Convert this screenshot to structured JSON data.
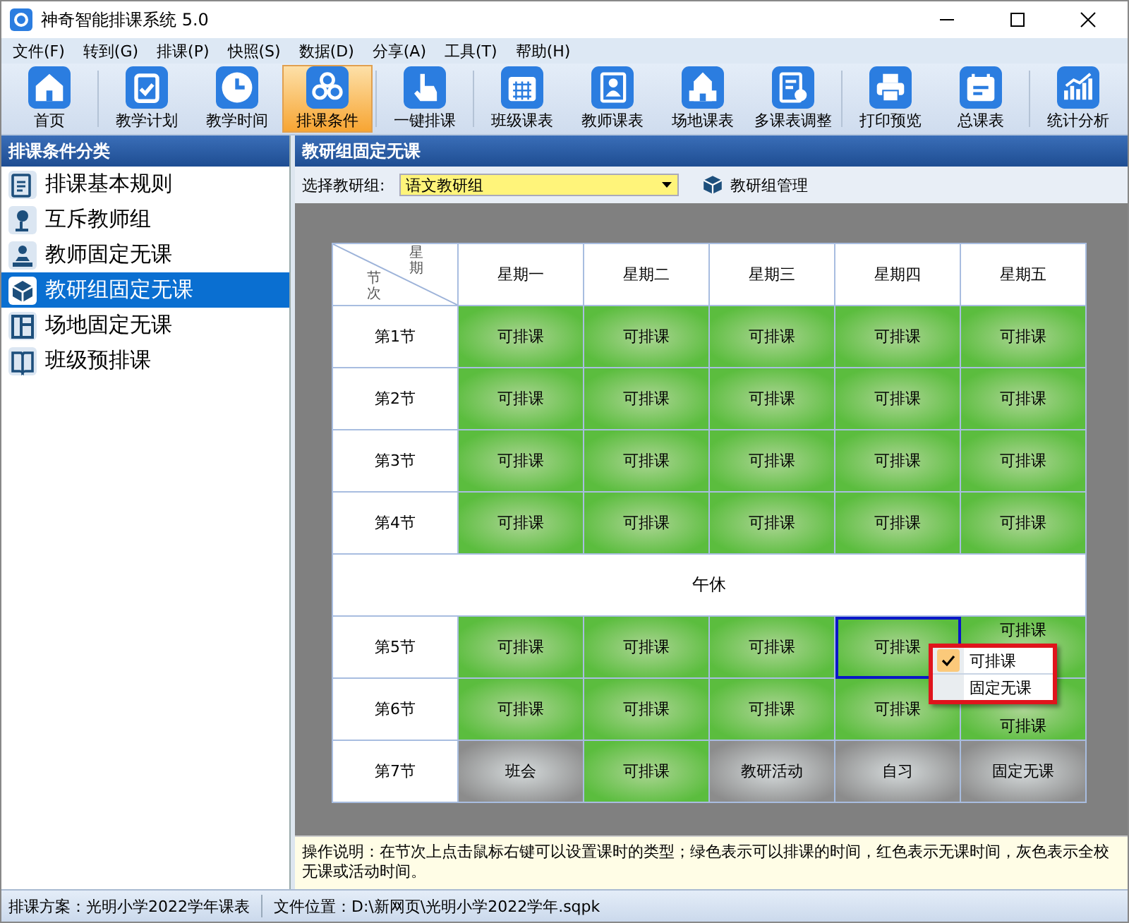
{
  "window": {
    "title": "神奇智能排课系统 5.0"
  },
  "menu": [
    "文件(F)",
    "转到(G)",
    "排课(P)",
    "快照(S)",
    "数据(D)",
    "分享(A)",
    "工具(T)",
    "帮助(H)"
  ],
  "toolbar": [
    [
      {
        "label": "首页",
        "selected": false
      }
    ],
    [
      {
        "label": "教学计划",
        "selected": false
      },
      {
        "label": "教学时间",
        "selected": false
      },
      {
        "label": "排课条件",
        "selected": true
      }
    ],
    [
      {
        "label": "一键排课",
        "selected": false
      }
    ],
    [
      {
        "label": "班级课表",
        "selected": false
      },
      {
        "label": "教师课表",
        "selected": false
      },
      {
        "label": "场地课表",
        "selected": false
      },
      {
        "label": "多课表调整",
        "selected": false
      }
    ],
    [
      {
        "label": "打印预览",
        "selected": false
      },
      {
        "label": "总课表",
        "selected": false
      }
    ],
    [
      {
        "label": "统计分析",
        "selected": false
      }
    ]
  ],
  "sidebar": {
    "title": "排课条件分类",
    "items": [
      {
        "label": "排课基本规则",
        "selected": false
      },
      {
        "label": "互斥教师组",
        "selected": false
      },
      {
        "label": "教师固定无课",
        "selected": false
      },
      {
        "label": "教研组固定无课",
        "selected": true
      },
      {
        "label": "场地固定无课",
        "selected": false
      },
      {
        "label": "班级预排课",
        "selected": false
      }
    ]
  },
  "panel": {
    "title": "教研组固定无课",
    "select_label": "选择教研组:",
    "select_value": "语文教研组",
    "manage_button": "教研组管理"
  },
  "table": {
    "corner_top": "星期",
    "corner_bottom": "节次",
    "columns": [
      "星期一",
      "星期二",
      "星期三",
      "星期四",
      "星期五"
    ],
    "rows": [
      {
        "kind": "period",
        "label": "第1节",
        "cells": [
          {
            "text": "可排课",
            "kind": "free",
            "selected": false
          },
          {
            "text": "可排课",
            "kind": "free",
            "selected": false
          },
          {
            "text": "可排课",
            "kind": "free",
            "selected": false
          },
          {
            "text": "可排课",
            "kind": "free",
            "selected": false
          },
          {
            "text": "可排课",
            "kind": "free",
            "selected": false
          }
        ]
      },
      {
        "kind": "period",
        "label": "第2节",
        "cells": [
          {
            "text": "可排课",
            "kind": "free",
            "selected": false
          },
          {
            "text": "可排课",
            "kind": "free",
            "selected": false
          },
          {
            "text": "可排课",
            "kind": "free",
            "selected": false
          },
          {
            "text": "可排课",
            "kind": "free",
            "selected": false
          },
          {
            "text": "可排课",
            "kind": "free",
            "selected": false
          }
        ]
      },
      {
        "kind": "period",
        "label": "第3节",
        "cells": [
          {
            "text": "可排课",
            "kind": "free",
            "selected": false
          },
          {
            "text": "可排课",
            "kind": "free",
            "selected": false
          },
          {
            "text": "可排课",
            "kind": "free",
            "selected": false
          },
          {
            "text": "可排课",
            "kind": "free",
            "selected": false
          },
          {
            "text": "可排课",
            "kind": "free",
            "selected": false
          }
        ]
      },
      {
        "kind": "period",
        "label": "第4节",
        "cells": [
          {
            "text": "可排课",
            "kind": "free",
            "selected": false
          },
          {
            "text": "可排课",
            "kind": "free",
            "selected": false
          },
          {
            "text": "可排课",
            "kind": "free",
            "selected": false
          },
          {
            "text": "可排课",
            "kind": "free",
            "selected": false
          },
          {
            "text": "可排课",
            "kind": "free",
            "selected": false
          }
        ]
      },
      {
        "kind": "break",
        "label": "午休"
      },
      {
        "kind": "period",
        "label": "第5节",
        "cells": [
          {
            "text": "可排课",
            "kind": "free",
            "selected": false
          },
          {
            "text": "可排课",
            "kind": "free",
            "selected": false
          },
          {
            "text": "可排课",
            "kind": "free",
            "selected": false
          },
          {
            "text": "可排课",
            "kind": "free",
            "selected": true
          },
          {
            "text": "可排课",
            "kind": "free",
            "selected": false
          }
        ]
      },
      {
        "kind": "period",
        "label": "第6节",
        "cells": [
          {
            "text": "可排课",
            "kind": "free",
            "selected": false
          },
          {
            "text": "可排课",
            "kind": "free",
            "selected": false
          },
          {
            "text": "可排课",
            "kind": "free",
            "selected": false
          },
          {
            "text": "可排课",
            "kind": "free",
            "selected": false
          },
          {
            "text": "可排课",
            "kind": "free",
            "selected": false
          }
        ]
      },
      {
        "kind": "period",
        "label": "第7节",
        "cells": [
          {
            "text": "班会",
            "kind": "fixed",
            "selected": false
          },
          {
            "text": "可排课",
            "kind": "free",
            "selected": false
          },
          {
            "text": "教研活动",
            "kind": "fixed",
            "selected": false
          },
          {
            "text": "自习",
            "kind": "fixed",
            "selected": false
          },
          {
            "text": "固定无课",
            "kind": "fixed",
            "selected": false
          }
        ]
      }
    ]
  },
  "context_menu": {
    "highlighted": true,
    "items": [
      {
        "label": "可排课",
        "checked": true
      },
      {
        "label": "固定无课",
        "checked": false
      }
    ]
  },
  "note": "操作说明：在节次上点击鼠标右键可以设置课时的类型；绿色表示可以排课的时间，红色表示无课时间，灰色表示全校无课或活动时间。",
  "status_bar": [
    "排课方案：光明小学2022学年课表",
    "文件位置：D:\\新网页\\光明小学2022学年.sqpk"
  ]
}
